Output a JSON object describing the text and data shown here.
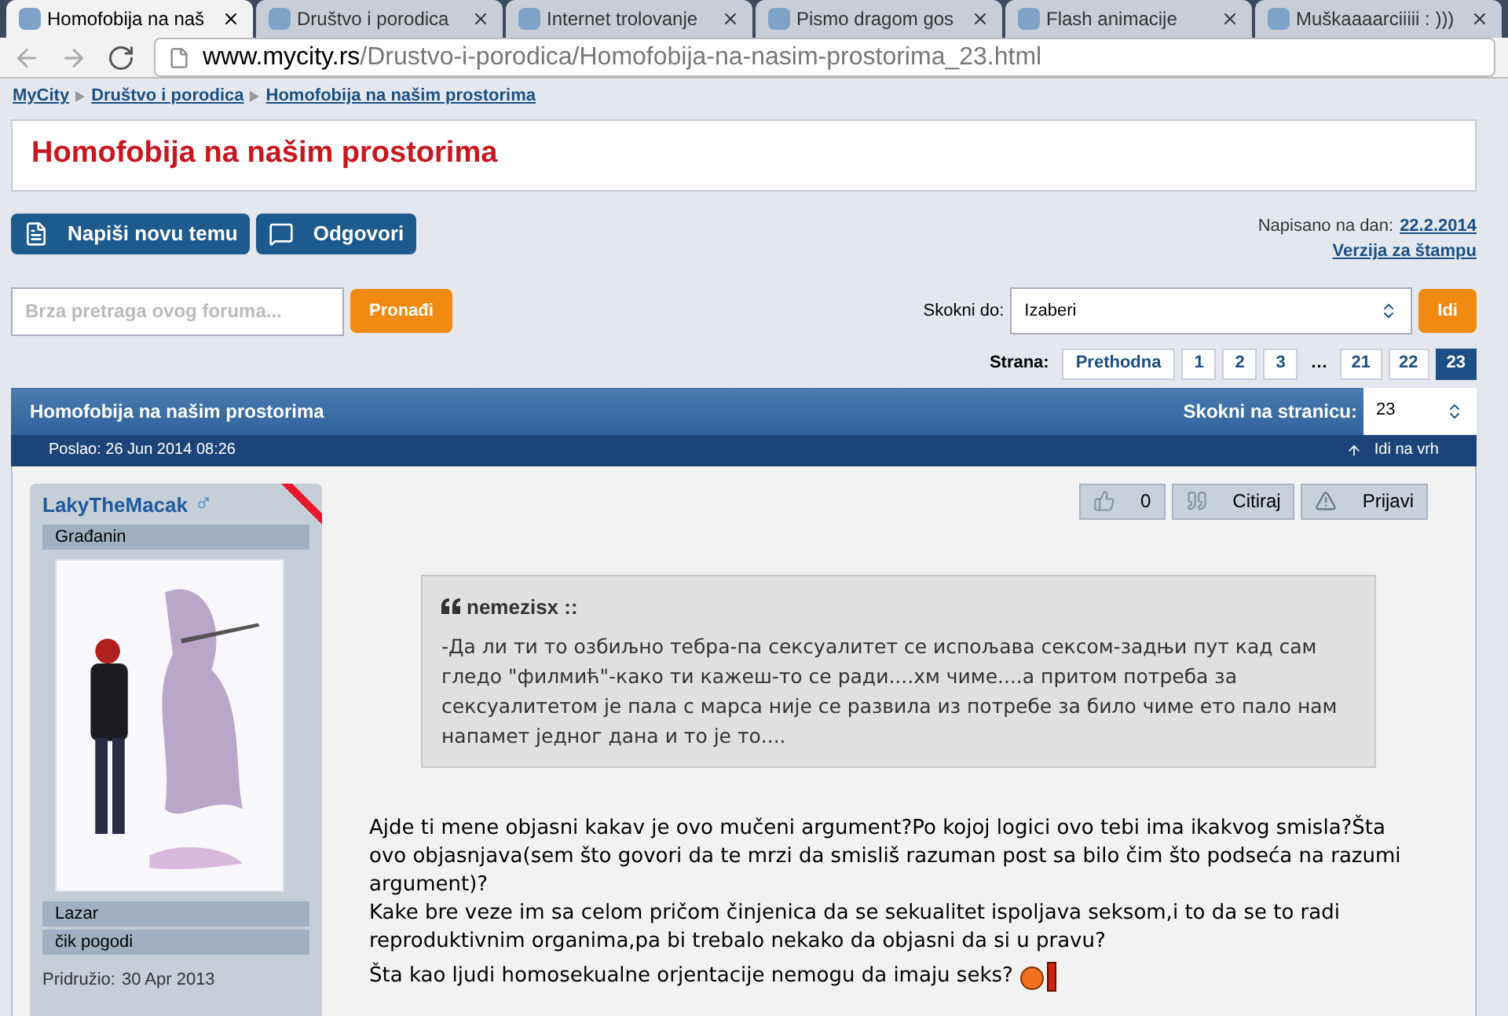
{
  "browser": {
    "tabs": [
      {
        "title": "Homofobija na naš",
        "selected": true
      },
      {
        "title": "Društvo i porodica",
        "selected": false
      },
      {
        "title": "Internet trolovanje",
        "selected": false
      },
      {
        "title": "Pismo dragom gos",
        "selected": false
      },
      {
        "title": "Flash animacije",
        "selected": false
      },
      {
        "title": "Muškaaaarciiiii : )))",
        "selected": false
      }
    ],
    "url_host": "www.mycity.rs",
    "url_path": "/Drustvo-i-porodica/Homofobija-na-nasim-prostorima_23.html"
  },
  "breadcrumb": [
    "MyCity",
    "Društvo i porodica",
    "Homofobija na našim prostorima"
  ],
  "page_title": "Homofobija na našim prostorima",
  "actions": {
    "new_topic": "Napiši novu temu",
    "reply": "Odgovori",
    "written_label": "Napisano na dan:",
    "written_date": "22.2.2014",
    "print_link": "Verzija za štampu"
  },
  "search": {
    "placeholder": "Brza pretraga ovog foruma...",
    "button": "Pronađi"
  },
  "jump": {
    "label": "Skokni do:",
    "value": "Izaberi",
    "button": "Idi"
  },
  "pagination": {
    "label": "Strana:",
    "prev": "Prethodna",
    "pages": [
      {
        "label": "1",
        "selected": false
      },
      {
        "label": "2",
        "selected": false
      },
      {
        "label": "3",
        "selected": false
      },
      {
        "label": "…",
        "kind": "gap"
      },
      {
        "label": "21",
        "selected": false
      },
      {
        "label": "22",
        "selected": false
      },
      {
        "label": "23",
        "selected": true
      }
    ]
  },
  "thread": {
    "title": "Homofobija na našim prostorima",
    "jump_page_label": "Skokni na stranicu:",
    "jump_page_value": "23",
    "posted": "Poslao: 26 Jun 2014 08:26",
    "to_top": "Idi na vrh"
  },
  "post": {
    "author": "LakyTheMacak",
    "author_symbol": "♂",
    "rank": "Građanin",
    "name": "Lazar",
    "motto": "čik pogodi",
    "joined_label": "Pridružio:",
    "joined_date": "30 Apr 2013",
    "buttons": {
      "likes": "0",
      "quote": "Citiraj",
      "report": "Prijavi"
    },
    "quote": {
      "author": "nemezisx ::",
      "text": "-Да ли ти то озбиљно тебра-па сексуалитет се испољава сексом-задњи пут кад сам гледо \"филмић\"-како ти кажеш-то се ради....хм чиме....а притом потреба за сексуалитетом је пала с марса није се развила из потребе за било чиме ето пало нам напамет једног дана и то је то...."
    },
    "paragraphs": [
      "Ajde ti mene objasni kakav je ovo mučeni argument?Po kojoj logici ovo tebi ima ikakvog smisla?Šta ovo objasnjava(sem što govori da te mrzi da smisliš razuman post sa bilo čim što podseća na razumi argument)?\nKake bre veze im sa celom pričom činjenica da se sekualitet ispoljava seksom,i to da se to radi reproduktivnim organima,pa bi trebalo nekako da objasni da si u pravu?",
      "Šta kao ljudi homosekualne orjentacije nemogu da imaju seks?"
    ]
  }
}
